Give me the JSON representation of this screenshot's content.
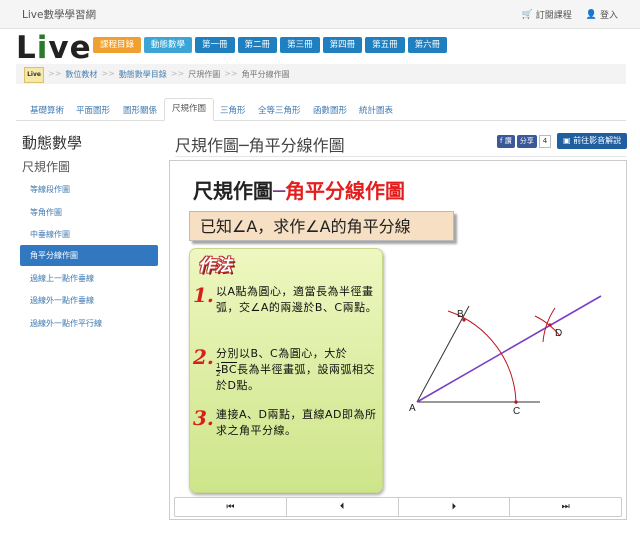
{
  "site": {
    "name": "Live數學學習網"
  },
  "top_links": [
    {
      "icon": "cart-icon",
      "label": "訂閱課程"
    },
    {
      "icon": "user-icon",
      "label": "登入"
    }
  ],
  "logo": {
    "text_l": "L",
    "text_i": "i",
    "text_ve": "ve"
  },
  "nav": [
    "課程目錄",
    "動態數學",
    "第一冊",
    "第二冊",
    "第三冊",
    "第四冊",
    "第五冊",
    "第六冊"
  ],
  "breadcrumb": {
    "logo_text": "Live",
    "sep": ">>",
    "items": [
      "數位教材",
      "動態數學目錄",
      "尺規作圖",
      "角平分線作圖"
    ]
  },
  "tabs": [
    "基礎算術",
    "平面圖形",
    "圖形關係",
    "尺規作圖",
    "三角形",
    "全等三角形",
    "函數圖形",
    "統計圖表"
  ],
  "sidebar": {
    "title": "動態數學",
    "subtitle": "尺規作圖",
    "items": [
      "等線段作圖",
      "等角作圖",
      "中垂線作圖",
      "角平分線作圖",
      "過線上一點作垂線",
      "過線外一點作垂線",
      "過線外一點作平行線"
    ]
  },
  "content": {
    "title": "尺規作圖─角平分線作圖",
    "share": {
      "fb_label": "f 讚",
      "share_label": "分享",
      "count": "4"
    },
    "video_button": "前往影音解說"
  },
  "lesson": {
    "title_black": "尺規作圖",
    "title_dash": "─",
    "title_red": "角平分線作圖",
    "given": "已知∠A，求作∠A的角平分線",
    "method_label": "作法",
    "steps": [
      {
        "num": "1.",
        "text": "以A點為圓心，適當長為半徑畫弧，交∠A的兩邊於B、C兩點。"
      },
      {
        "num": "2.",
        "text_a": "分別以B、C為圓心，大於",
        "frac_n": "1",
        "frac_d": "2",
        "seg": "BC",
        "text_b": "長為半徑畫弧，設兩弧相交於D點。"
      },
      {
        "num": "3.",
        "text": "連接A、D兩點，直線AD即為所求之角平分線。"
      }
    ],
    "diagram_labels": {
      "A": "A",
      "B": "B",
      "C": "C",
      "D": "D"
    },
    "colors": {
      "bisector": "#7a3fc4",
      "arc": "#c0141e",
      "point": "#c0141e"
    }
  },
  "controls": [
    {
      "icon": "first-icon",
      "glyph": "⏮"
    },
    {
      "icon": "prev-icon",
      "glyph": "⏴"
    },
    {
      "icon": "next-icon",
      "glyph": "⏵"
    },
    {
      "icon": "last-icon",
      "glyph": "⏭"
    }
  ]
}
